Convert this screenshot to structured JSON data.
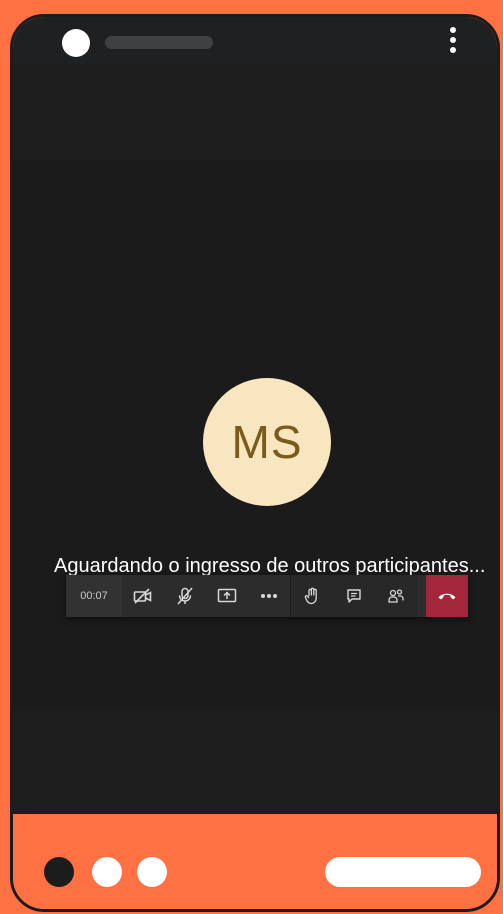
{
  "call": {
    "avatar_initials": "MS",
    "waiting_message": "Aguardando o ingresso de outros participantes...",
    "timer": "00:07"
  },
  "toolbar": {
    "buttons": [
      {
        "icon": "camera-off-icon"
      },
      {
        "icon": "mic-off-icon"
      },
      {
        "icon": "share-screen-icon"
      },
      {
        "icon": "more-options-icon"
      },
      {
        "icon": "raise-hand-icon"
      },
      {
        "icon": "chat-icon"
      },
      {
        "icon": "participants-icon"
      },
      {
        "icon": "hang-up-icon"
      }
    ]
  },
  "colors": {
    "frame_accent": "#ff7043",
    "call_background": "#1b1b1b",
    "avatar_bg": "#f8e6c1",
    "avatar_text": "#7a5c1a",
    "hangup": "#a4263b"
  }
}
